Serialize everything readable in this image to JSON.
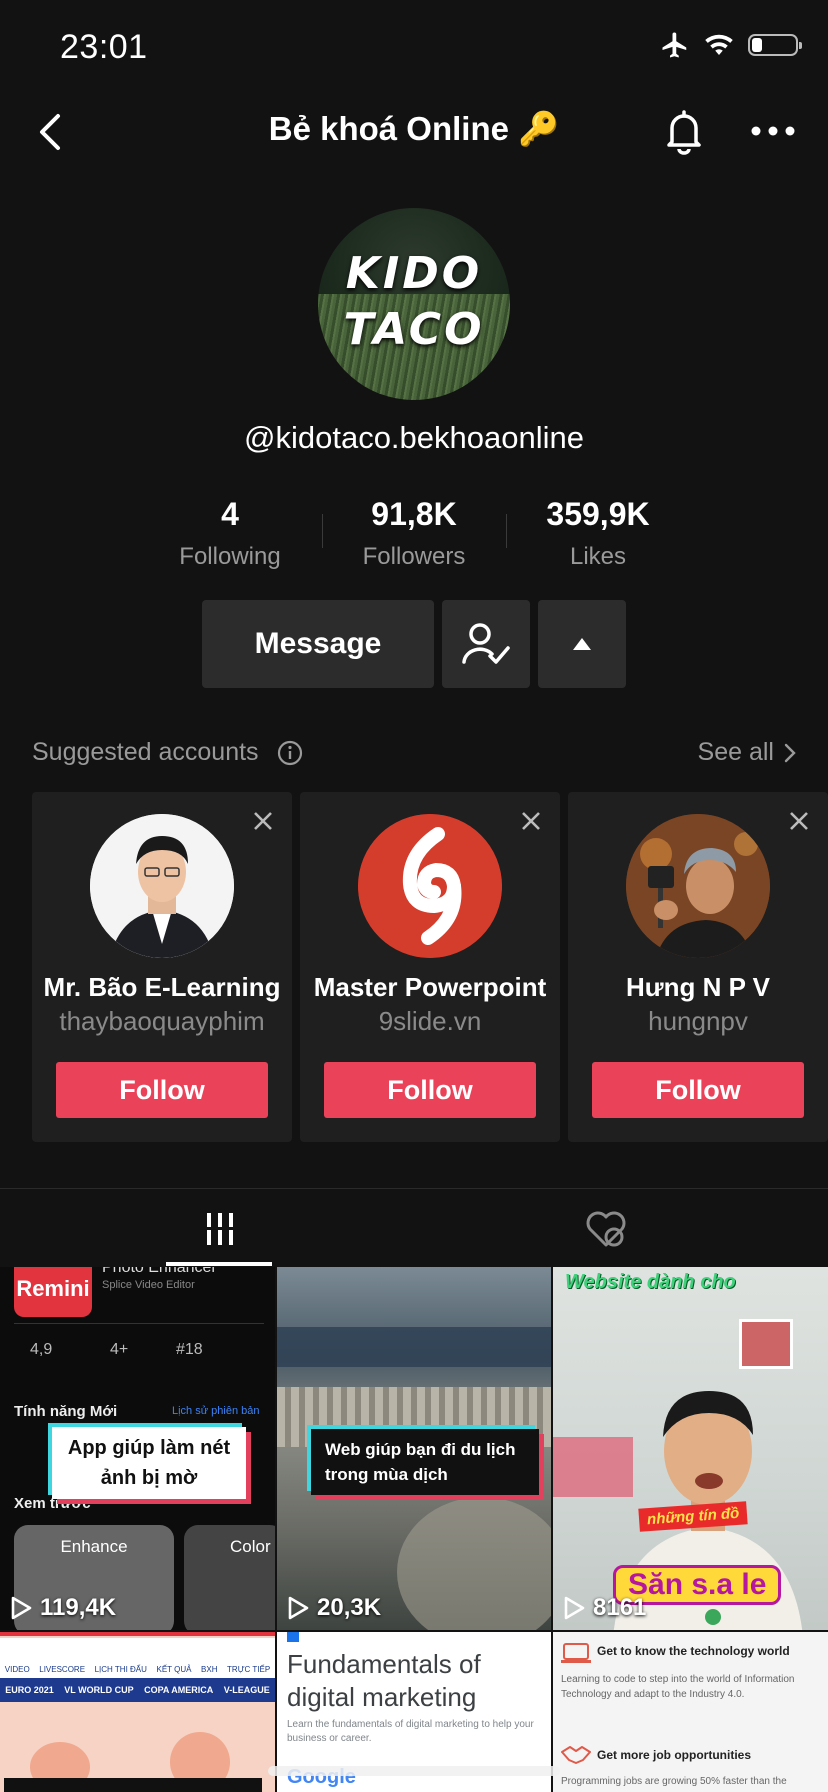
{
  "status_bar": {
    "time": "23:01"
  },
  "header": {
    "title": "Bẻ khoá Online 🔑"
  },
  "profile": {
    "avatar_text_line1": "KIDO",
    "avatar_text_line2": "TACO",
    "username": "@kidotaco.bekhoaonline",
    "stats": [
      {
        "value": "4",
        "label": "Following"
      },
      {
        "value": "91,8K",
        "label": "Followers"
      },
      {
        "value": "359,9K",
        "label": "Likes"
      }
    ],
    "message_label": "Message"
  },
  "suggested": {
    "title": "Suggested accounts",
    "see_all": "See all",
    "accounts": [
      {
        "name": "Mr. Bão E-Learning",
        "handle": "thaybaoquayphim",
        "follow": "Follow"
      },
      {
        "name": "Master Powerpoint",
        "handle": "9slide.vn",
        "follow": "Follow"
      },
      {
        "name": "Hưng N P V",
        "handle": "hungnpv",
        "follow": "Follow"
      }
    ]
  },
  "videos": [
    {
      "views": "119,4K",
      "caption": "App giúp làm nét ảnh bị mờ",
      "screen_text": {
        "app_name": "Remini",
        "sub_title": "Photo Enhancer",
        "publisher": "Splice Video Editor",
        "rating": "4,9",
        "age": "4+",
        "rank": "#18",
        "new_features": "Tính năng Mới",
        "version_history": "Lịch sử phiên bản",
        "preview": "Xem trước",
        "enhance": "Enhance",
        "color": "Color"
      }
    },
    {
      "views": "20,3K",
      "caption": "Web giúp bạn đi du lịch trong mùa dịch"
    },
    {
      "views": "8161",
      "overlay_top": "Website dành cho",
      "overlay_mid": "những tín đồ",
      "overlay_bottom": "Săn s.a le"
    },
    {
      "nav": [
        "VIDEO",
        "LIVESCORE",
        "LỊCH THI ĐẤU",
        "KẾT QUẢ",
        "BXH",
        "TRỰC TIẾP"
      ],
      "leagues": [
        "EURO 2021",
        "VL WORLD CUP",
        "COPA AMERICA",
        "V-LEAGUE"
      ]
    },
    {
      "title": "Fundamentals of digital marketing",
      "desc": "Learn the fundamentals of digital marketing to help your business or career.",
      "brand": "Google"
    },
    {
      "heading1": "Get to know the technology world",
      "body1": "Learning to code to step into the world of Information Technology and adapt to the Industry 4.0.",
      "heading2": "Get more job opportunities",
      "body2": "Programming jobs are growing 50% faster than the"
    }
  ]
}
